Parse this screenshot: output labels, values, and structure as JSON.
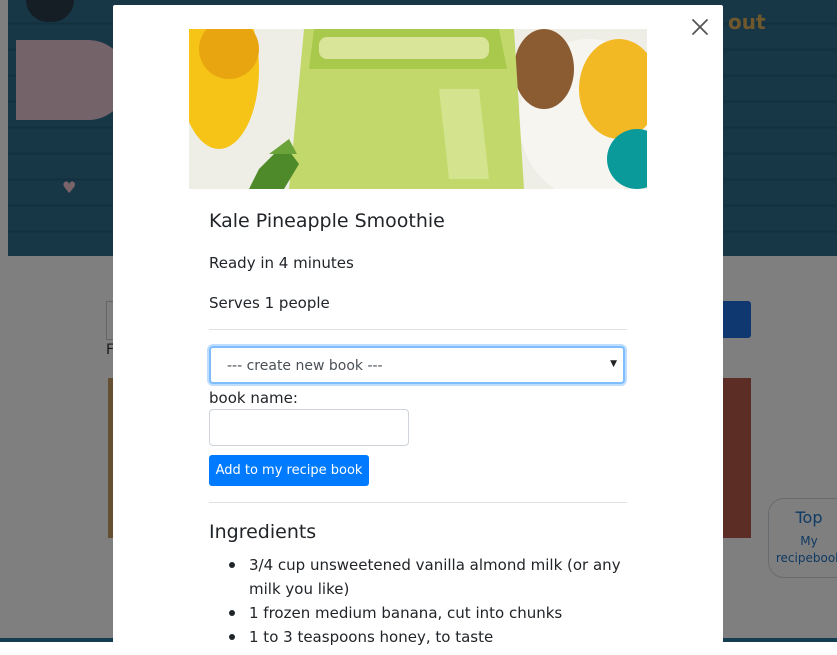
{
  "background": {
    "hero_text": "out",
    "letter": "F",
    "top_widget": {
      "title": "Top",
      "sub_line1": "My",
      "sub_line2": "recipebook"
    }
  },
  "modal": {
    "close_icon": "close-icon",
    "image_alt": "Kale Pineapple Smoothie",
    "title": "Kale Pineapple Smoothie",
    "ready_text": "Ready in 4 minutes",
    "serves_text": "Serves 1 people",
    "book_select": {
      "selected": "--- create new book ---",
      "caret_icon": "caret-down-icon"
    },
    "book_name_label": "book name:",
    "book_name_value": "",
    "add_button_label": "Add to my recipe book",
    "ingredients_heading": "Ingredients",
    "ingredients": [
      "3/4 cup unsweetened vanilla almond milk (or any milk you like)",
      "1 frozen medium banana, cut into chunks",
      "1 to 3 teaspoons honey, to taste"
    ]
  },
  "colors": {
    "primary": "#007bff",
    "overlay": "rgba(0,0,0,0.5)",
    "text": "#212529"
  }
}
